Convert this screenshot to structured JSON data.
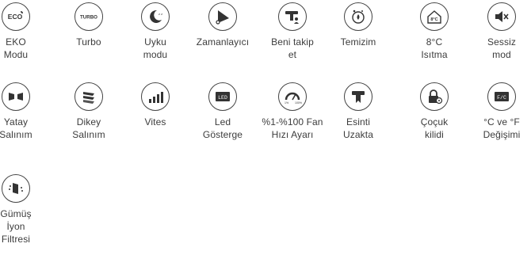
{
  "features": [
    {
      "label": "EKO\nModu",
      "icon": "eco-icon",
      "badge": "ECO"
    },
    {
      "label": "Turbo",
      "icon": "turbo-icon",
      "badge": "TURBO"
    },
    {
      "label": "Uyku\nmodu",
      "icon": "moon-icon"
    },
    {
      "label": "Zamanlayıcı",
      "icon": "timer-icon"
    },
    {
      "label": "Beni takip\net",
      "icon": "follow-me-icon"
    },
    {
      "label": "Temizim",
      "icon": "clean-icon"
    },
    {
      "label": "8°C\nIsıtma",
      "icon": "heating-8c-icon",
      "badge": "8°C"
    },
    {
      "label": "Sessiz\nmod",
      "icon": "mute-icon"
    },
    {
      "label": "Yatay\nSalınım",
      "icon": "horizontal-swing-icon"
    },
    {
      "label": "Dikey\nSalınım",
      "icon": "vertical-swing-icon"
    },
    {
      "label": "Vites",
      "icon": "fan-speed-bars-icon"
    },
    {
      "label": "Led\nGösterge",
      "icon": "led-display-icon",
      "badge": "LED"
    },
    {
      "label": "%1-%100 Fan\nHızı Ayarı",
      "icon": "fan-speed-gauge-icon",
      "badge": "1%",
      "badge2": "100%"
    },
    {
      "label": "Esinti\nUzakta",
      "icon": "breeze-away-icon"
    },
    {
      "label": "Çoçuk\nkilidi",
      "icon": "child-lock-icon"
    },
    {
      "label": "°C ve °F\nDeğişimi",
      "icon": "celsius-fahrenheit-icon",
      "badge": "F/C"
    },
    {
      "label": "Gümüş\nİyon\nFiltresi",
      "icon": "silver-ion-filter-icon"
    }
  ]
}
